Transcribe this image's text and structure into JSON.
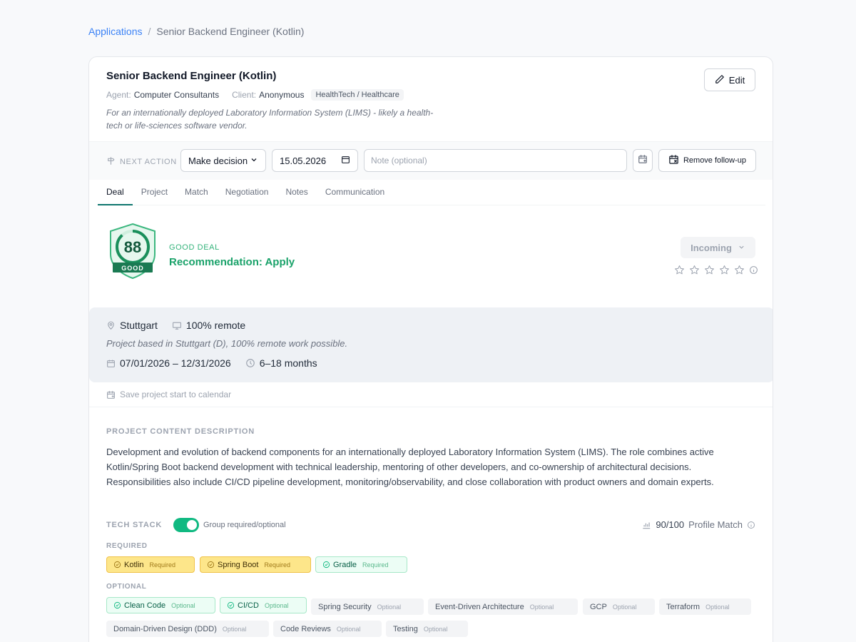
{
  "breadcrumb": {
    "root": "Applications",
    "separator": "/",
    "current": "Senior Backend Engineer (Kotlin)"
  },
  "header": {
    "title": "Senior Backend Engineer (Kotlin)",
    "agent_label": "Agent:",
    "agent": "Computer Consultants",
    "client_label": "Client:",
    "client": "Anonymous",
    "industry_tag": "HealthTech / Healthcare",
    "description": "For an internationally deployed Laboratory Information System (LIMS) - likely a health-tech or life-sciences software vendor.",
    "edit_label": "Edit"
  },
  "next_action": {
    "label": "NEXT ACTION",
    "selected": "Make decision",
    "date": "15.05.2026",
    "note_placeholder": "Note (optional)",
    "remove_label": "Remove follow-up"
  },
  "tabs": [
    "Deal",
    "Project",
    "Match",
    "Negotiation",
    "Notes",
    "Communication"
  ],
  "deal": {
    "score": "88",
    "score_label": "GOOD",
    "category": "GOOD DEAL",
    "recommendation": "Recommendation: Apply",
    "status": "Incoming",
    "rating": 0,
    "rating_max": 5
  },
  "location": {
    "city": "Stuttgart",
    "remote": "100% remote",
    "description": "Project based in Stuttgart (D), 100% remote work possible.",
    "dates": "07/01/2026 – 12/31/2026",
    "duration": "6–18 months",
    "save_calendar": "Save project start to calendar"
  },
  "content": {
    "title": "PROJECT CONTENT DESCRIPTION",
    "text": "Development and evolution of backend components for an internationally deployed Laboratory Information System (LIMS). The role combines active Kotlin/Spring Boot backend development with technical leadership, mentoring of other developers, and co-ownership of architectural decisions. Responsibilities also include CI/CD pipeline development, monitoring/observability, and close collaboration with product owners and domain experts."
  },
  "tech_stack": {
    "title": "TECH STACK",
    "toggle_label": "Group required/optional",
    "toggle_on": true,
    "match_score": "90/100",
    "match_label": "Profile Match",
    "required_label": "REQUIRED",
    "optional_label": "OPTIONAL",
    "required": [
      {
        "name": "Kotlin",
        "tag": "Required"
      },
      {
        "name": "Spring Boot",
        "tag": "Required"
      },
      {
        "name": "Gradle",
        "tag": "Required"
      }
    ],
    "optional": [
      {
        "name": "Clean Code",
        "tag": "Optional"
      },
      {
        "name": "CI/CD",
        "tag": "Optional"
      },
      {
        "name": "Spring Security",
        "tag": "Optional"
      },
      {
        "name": "Event-Driven Architecture",
        "tag": "Optional"
      },
      {
        "name": "GCP",
        "tag": "Optional"
      },
      {
        "name": "Terraform",
        "tag": "Optional"
      },
      {
        "name": "Domain-Driven Design (DDD)",
        "tag": "Optional"
      },
      {
        "name": "Code Reviews",
        "tag": "Optional"
      },
      {
        "name": "Testing",
        "tag": "Optional"
      }
    ]
  },
  "colors": {
    "accent": "#10b981",
    "link": "#3b82f6",
    "good": "#1aa26a",
    "required_chip": "#fde68a"
  }
}
